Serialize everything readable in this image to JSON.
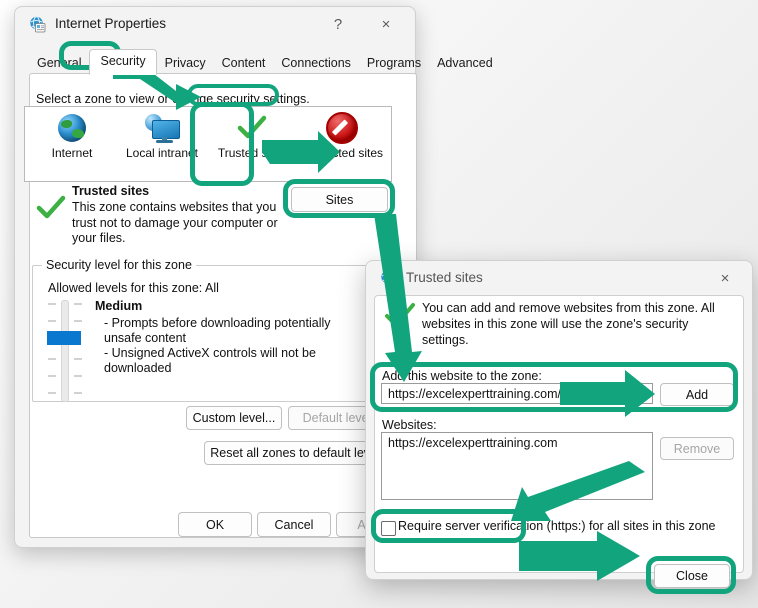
{
  "accent": {
    "highlight_green": "#12a47c",
    "check_green": "#3cb043",
    "slider_blue": "#0b78d0",
    "restricted_red": "#c00000"
  },
  "main_dialog": {
    "title": "Internet Properties",
    "icon": "internet-properties-icon",
    "help_button": "?",
    "close_button": "×",
    "tabs": [
      {
        "label": "General",
        "active": false
      },
      {
        "label": "Security",
        "active": true
      },
      {
        "label": "Privacy",
        "active": false
      },
      {
        "label": "Content",
        "active": false
      },
      {
        "label": "Connections",
        "active": false
      },
      {
        "label": "Programs",
        "active": false
      },
      {
        "label": "Advanced",
        "active": false
      }
    ],
    "zone_prompt": "Select a zone to view or change security settings.",
    "zones": [
      {
        "label": "Internet",
        "icon": "globe-icon"
      },
      {
        "label": "Local intranet",
        "icon": "intranet-monitor-icon"
      },
      {
        "label": "Trusted sites",
        "icon": "green-check-icon",
        "selected": true
      },
      {
        "label": "Restricted sites",
        "icon": "no-entry-icon"
      }
    ],
    "zone_description": {
      "icon": "green-check-icon",
      "heading": "Trusted sites",
      "body": "This zone contains websites that you trust not to damage your computer or your files."
    },
    "sites_button": "Sites",
    "security_level": {
      "group_title": "Security level for this zone",
      "allowed_levels": "Allowed levels for this zone: All",
      "level_name": "Medium",
      "bullets": [
        "- Prompts before downloading potentially unsafe content",
        "- Unsigned ActiveX controls will not be downloaded"
      ]
    },
    "custom_level_button": "Custom level...",
    "default_level_button": "Default level",
    "reset_button": "Reset all zones to default level",
    "ok_button": "OK",
    "cancel_button": "Cancel",
    "apply_button": "Apply"
  },
  "trusted_sites_dialog": {
    "title": "Trusted sites",
    "icon": "internet-properties-icon",
    "close_button": "×",
    "info_icon": "green-check-icon",
    "info_text": "You can add and remove websites from this zone. All websites in this zone will use the zone's security settings.",
    "add_label": "Add this website to the zone:",
    "add_input_value": "https://excelexperttraining.com/",
    "add_input_placeholder": "",
    "add_button": "Add",
    "websites_label": "Websites:",
    "websites": [
      "https://excelexperttraining.com"
    ],
    "remove_button": "Remove",
    "require_verification_label": "Require server verification (https:) for all sites in this zone",
    "require_verification_checked": false,
    "close_text_button": "Close"
  },
  "annotations": {
    "highlighted": [
      "security-tab",
      "zone-prompt-text",
      "trusted-sites-zone",
      "sites-button",
      "add-website-row",
      "require-verification-checkbox",
      "close-button"
    ],
    "arrow_count": 5
  }
}
